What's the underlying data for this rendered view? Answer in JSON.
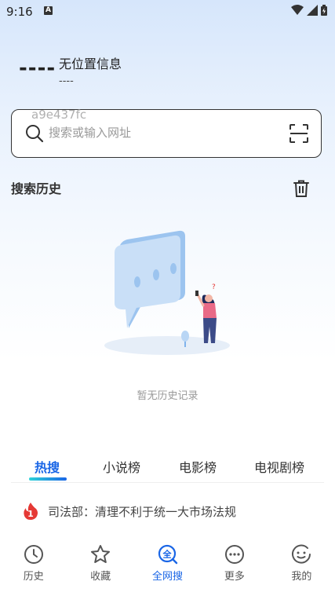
{
  "status_bar": {
    "time": "9:16",
    "notif_letter": "A"
  },
  "location": {
    "dash": "----",
    "title": "无位置信息",
    "subtitle": "----"
  },
  "search": {
    "watermark": "a9e437fc",
    "placeholder": "搜索或输入网址"
  },
  "history": {
    "title": "搜索历史",
    "empty_text": "暂无历史记录"
  },
  "tabs": [
    {
      "label": "热搜",
      "active": true
    },
    {
      "label": "小说榜",
      "active": false
    },
    {
      "label": "电影榜",
      "active": false
    },
    {
      "label": "电视剧榜",
      "active": false
    }
  ],
  "hot_items": [
    {
      "rank": "1",
      "text": "司法部：清理不利于统一大市场法规"
    }
  ],
  "bottom_nav": [
    {
      "label": "历史",
      "icon": "clock-icon",
      "active": false
    },
    {
      "label": "收藏",
      "icon": "star-icon",
      "active": false
    },
    {
      "label": "全网搜",
      "icon": "global-search-icon",
      "active": true
    },
    {
      "label": "更多",
      "icon": "more-icon",
      "active": false
    },
    {
      "label": "我的",
      "icon": "profile-icon",
      "active": false
    }
  ],
  "colors": {
    "accent": "#1a66e6",
    "hot_red": "#e53935"
  }
}
